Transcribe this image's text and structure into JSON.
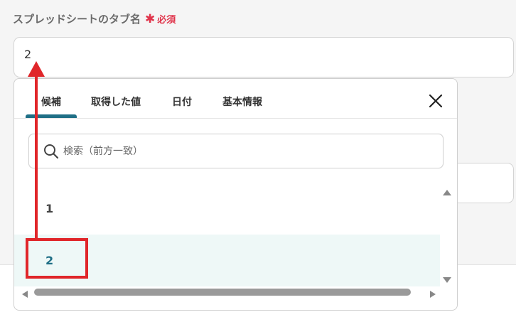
{
  "field": {
    "label": "スプレッドシートのタブ名",
    "required_mark": "✱",
    "required_text": "必須",
    "value": "2"
  },
  "popup": {
    "tabs": [
      {
        "label": "候補",
        "active": true
      },
      {
        "label": "取得した値",
        "active": false
      },
      {
        "label": "日付",
        "active": false
      },
      {
        "label": "基本情報",
        "active": false
      }
    ],
    "close_icon": "close-icon",
    "search": {
      "placeholder": "検索（前方一致）",
      "icon": "search-icon"
    },
    "items": [
      {
        "label": "1",
        "selected": false
      },
      {
        "label": "2",
        "selected": true
      }
    ]
  },
  "colors": {
    "accent": "#1f6f86",
    "required": "#e0344b",
    "annotation": "#e0262a",
    "selected_bg": "#eef8f7"
  }
}
